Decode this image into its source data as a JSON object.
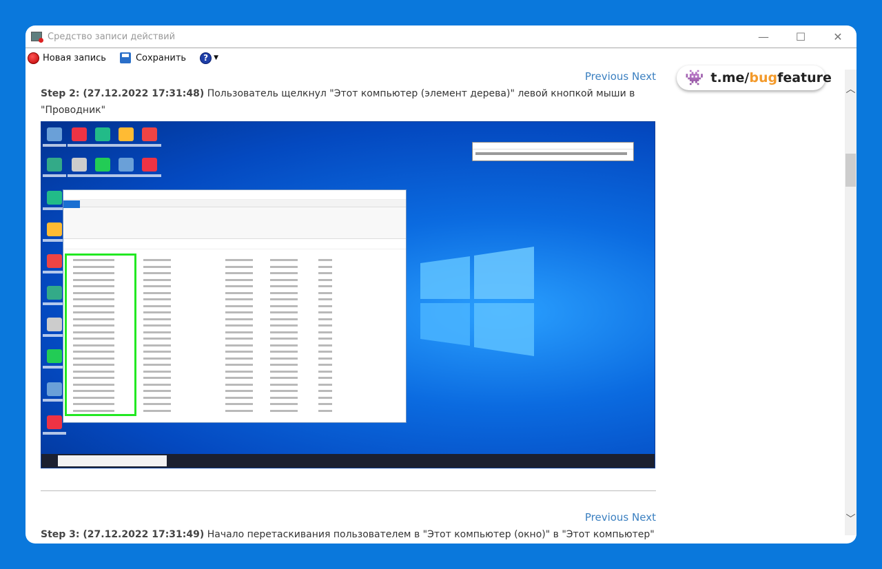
{
  "window": {
    "title": "Средство записи действий",
    "controls": {
      "minimize": "—",
      "maximize": "☐",
      "close": "✕"
    }
  },
  "toolbar": {
    "new_record": "Новая запись",
    "save": "Сохранить",
    "help": "?"
  },
  "badge": {
    "prefix": "t.me/",
    "highlight": "bug",
    "suffix": "feature",
    "highlight_color": "#f39a2b"
  },
  "steps": [
    {
      "nav_prev": "Previous",
      "nav_next": "Next",
      "label": "Step 2: (27.12.2022 17:31:48)",
      "text": "Пользователь щелкнул \"Этот компьютер (элемент дерева)\" левой кнопкой мыши в \"Проводник\""
    },
    {
      "nav_prev": "Previous",
      "nav_next": "Next",
      "label": "Step 3: (27.12.2022 17:31:49)",
      "text": "Начало перетаскивания пользователем в \"Этот компьютер (окно)\" в \"Этот компьютер\""
    }
  ],
  "colors": {
    "background": "#0a78dc",
    "link": "#3a7fc0",
    "highlight_box": "#22e822"
  }
}
